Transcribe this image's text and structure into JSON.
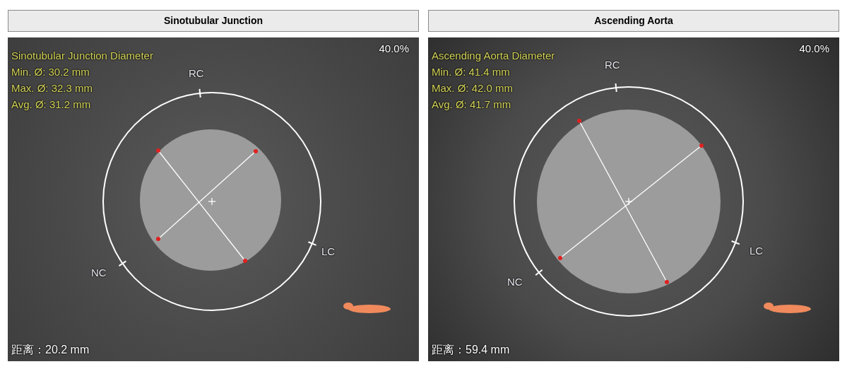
{
  "panels": [
    {
      "title": "Sinotubular Junction",
      "measurement": {
        "title": "Sinotubular Junction Diameter",
        "lines": [
          "Min. Ø: 30.2 mm",
          "Max. Ø: 32.3 mm",
          "Avg. Ø: 31.2 mm"
        ]
      },
      "zoom": "40.0%",
      "distance": "距离：20.2 mm",
      "markers": [
        "RC",
        "NC",
        "LC"
      ]
    },
    {
      "title": "Ascending Aorta",
      "measurement": {
        "title": "Ascending Aorta Diameter",
        "lines": [
          "Min. Ø: 41.4 mm",
          "Max. Ø: 42.0 mm",
          "Avg. Ø: 41.7 mm"
        ]
      },
      "zoom": "40.0%",
      "distance": "距离：59.4 mm",
      "markers": [
        "RC",
        "NC",
        "LC"
      ]
    }
  ]
}
